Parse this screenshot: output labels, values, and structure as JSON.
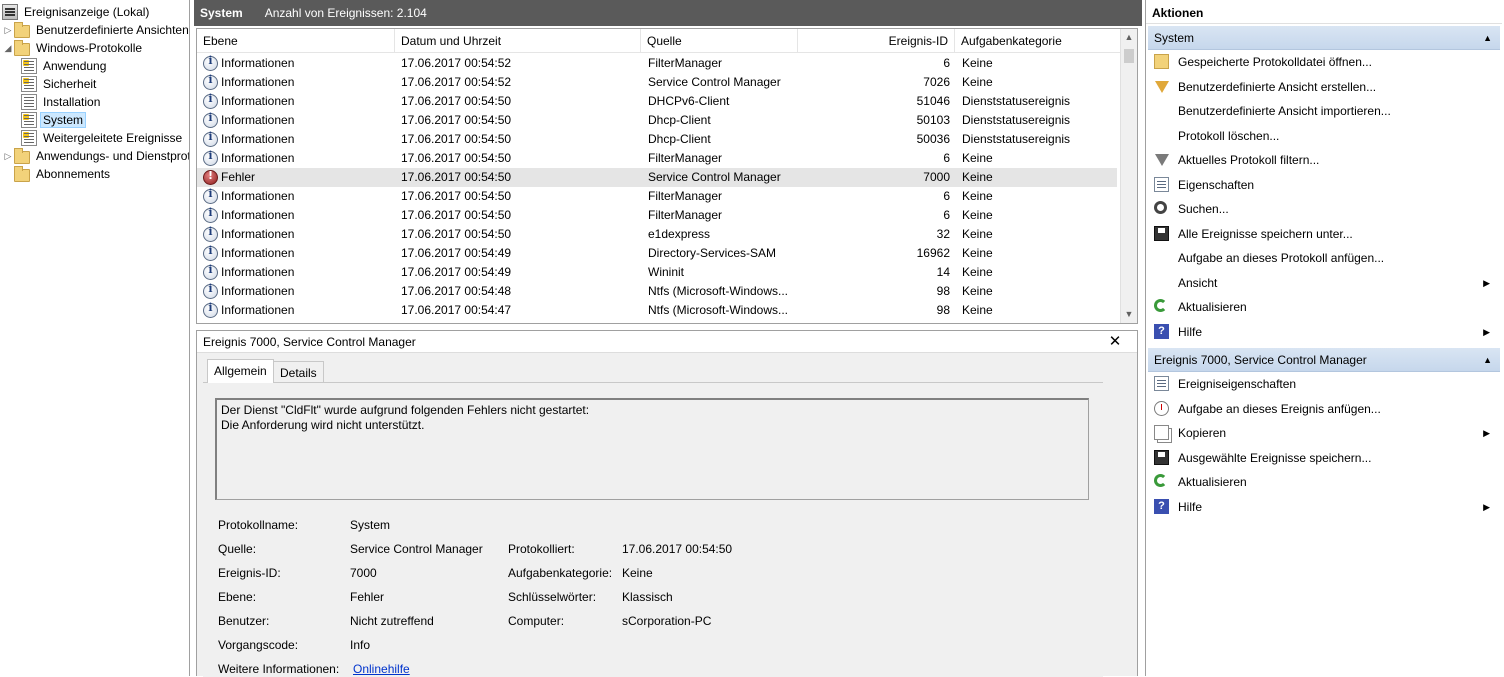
{
  "tree": {
    "root": "Ereignisanzeige (Lokal)",
    "items": [
      {
        "label": "Benutzerdefinierte Ansichten",
        "level": 1,
        "expander": "▷"
      },
      {
        "label": "Windows-Protokolle",
        "level": 1,
        "expander": "◢"
      },
      {
        "label": "Anwendung",
        "level": 2
      },
      {
        "label": "Sicherheit",
        "level": 2
      },
      {
        "label": "Installation",
        "level": 2
      },
      {
        "label": "System",
        "level": 2,
        "selected": true
      },
      {
        "label": "Weitergeleitete Ereignisse",
        "level": 2
      },
      {
        "label": "Anwendungs- und Dienstprotokolle",
        "level": 1,
        "expander": "▷"
      },
      {
        "label": "Abonnements",
        "level": 1
      }
    ]
  },
  "topbar": {
    "title": "System",
    "count": "Anzahl von Ereignissen: 2.104"
  },
  "list": {
    "columns": [
      "Ebene",
      "Datum und Uhrzeit",
      "Quelle",
      "Ereignis-ID",
      "Aufgabenkategorie"
    ],
    "rows": [
      {
        "level": "Informationen",
        "icon": "info",
        "date": "17.06.2017 00:54:52",
        "source": "FilterManager",
        "id": "6",
        "category": "Keine"
      },
      {
        "level": "Informationen",
        "icon": "info",
        "date": "17.06.2017 00:54:52",
        "source": "Service Control Manager",
        "id": "7026",
        "category": "Keine"
      },
      {
        "level": "Informationen",
        "icon": "info",
        "date": "17.06.2017 00:54:50",
        "source": "DHCPv6-Client",
        "id": "51046",
        "category": "Dienststatusereignis"
      },
      {
        "level": "Informationen",
        "icon": "info",
        "date": "17.06.2017 00:54:50",
        "source": "Dhcp-Client",
        "id": "50103",
        "category": "Dienststatusereignis"
      },
      {
        "level": "Informationen",
        "icon": "info",
        "date": "17.06.2017 00:54:50",
        "source": "Dhcp-Client",
        "id": "50036",
        "category": "Dienststatusereignis"
      },
      {
        "level": "Informationen",
        "icon": "info",
        "date": "17.06.2017 00:54:50",
        "source": "FilterManager",
        "id": "6",
        "category": "Keine"
      },
      {
        "level": "Fehler",
        "icon": "error",
        "date": "17.06.2017 00:54:50",
        "source": "Service Control Manager",
        "id": "7000",
        "category": "Keine",
        "selected": true
      },
      {
        "level": "Informationen",
        "icon": "info",
        "date": "17.06.2017 00:54:50",
        "source": "FilterManager",
        "id": "6",
        "category": "Keine"
      },
      {
        "level": "Informationen",
        "icon": "info",
        "date": "17.06.2017 00:54:50",
        "source": "FilterManager",
        "id": "6",
        "category": "Keine"
      },
      {
        "level": "Informationen",
        "icon": "info",
        "date": "17.06.2017 00:54:50",
        "source": "e1dexpress",
        "id": "32",
        "category": "Keine"
      },
      {
        "level": "Informationen",
        "icon": "info",
        "date": "17.06.2017 00:54:49",
        "source": "Directory-Services-SAM",
        "id": "16962",
        "category": "Keine"
      },
      {
        "level": "Informationen",
        "icon": "info",
        "date": "17.06.2017 00:54:49",
        "source": "Wininit",
        "id": "14",
        "category": "Keine"
      },
      {
        "level": "Informationen",
        "icon": "info",
        "date": "17.06.2017 00:54:48",
        "source": "Ntfs (Microsoft-Windows...",
        "id": "98",
        "category": "Keine"
      },
      {
        "level": "Informationen",
        "icon": "info",
        "date": "17.06.2017 00:54:47",
        "source": "Ntfs (Microsoft-Windows...",
        "id": "98",
        "category": "Keine"
      }
    ]
  },
  "detail": {
    "title": "Ereignis 7000, Service Control Manager",
    "close": "✕",
    "tabs": [
      "Allgemein",
      "Details"
    ],
    "message_line1": "Der Dienst \"CldFlt\" wurde aufgrund folgenden Fehlers nicht gestartet:",
    "message_line2": "Die Anforderung wird nicht unterstützt.",
    "labels": {
      "log_name": "Protokollname:",
      "source": "Quelle:",
      "event_id": "Ereignis-ID:",
      "level": "Ebene:",
      "user": "Benutzer:",
      "opcode": "Vorgangscode:",
      "more_info": "Weitere Informationen:",
      "logged": "Protokolliert:",
      "task_category": "Aufgabenkategorie:",
      "keywords": "Schlüsselwörter:",
      "computer": "Computer:"
    },
    "values": {
      "log_name": "System",
      "source": "Service Control Manager",
      "event_id": "7000",
      "level": "Fehler",
      "user": "Nicht zutreffend",
      "opcode": "Info",
      "more_info": "Onlinehilfe",
      "logged": "17.06.2017 00:54:50",
      "task_category": "Keine",
      "keywords": "Klassisch",
      "computer": "sCorporation-PC"
    }
  },
  "actions": {
    "title": "Aktionen",
    "section1": "System",
    "section1_items": [
      {
        "label": "Gespeicherte Protokolldatei öffnen...",
        "icon": "open"
      },
      {
        "label": "Benutzerdefinierte Ansicht erstellen...",
        "icon": "filter-color"
      },
      {
        "label": "Benutzerdefinierte Ansicht importieren...",
        "icon": "none"
      },
      {
        "label": "Protokoll löschen...",
        "icon": "none"
      },
      {
        "label": "Aktuelles Protokoll filtern...",
        "icon": "filter"
      },
      {
        "label": "Eigenschaften",
        "icon": "props"
      },
      {
        "label": "Suchen...",
        "icon": "find"
      },
      {
        "label": "Alle Ereignisse speichern unter...",
        "icon": "save"
      },
      {
        "label": "Aufgabe an dieses Protokoll anfügen...",
        "icon": "none"
      },
      {
        "label": "Ansicht",
        "icon": "none",
        "submenu": true
      },
      {
        "label": "Aktualisieren",
        "icon": "refresh"
      },
      {
        "label": "Hilfe",
        "icon": "help",
        "submenu": true
      }
    ],
    "section2": "Ereignis 7000, Service Control Manager",
    "section2_items": [
      {
        "label": "Ereigniseigenschaften",
        "icon": "props"
      },
      {
        "label": "Aufgabe an dieses Ereignis anfügen...",
        "icon": "clock"
      },
      {
        "label": "Kopieren",
        "icon": "copy",
        "submenu": true
      },
      {
        "label": "Ausgewählte Ereignisse speichern...",
        "icon": "save"
      },
      {
        "label": "Aktualisieren",
        "icon": "refresh"
      },
      {
        "label": "Hilfe",
        "icon": "help",
        "submenu": true
      }
    ],
    "colors": {
      "section_bg": "#c6d7ec",
      "selection": "#cce8ff"
    }
  },
  "glyphs": {
    "submenu": "▶",
    "collapse": "▲",
    "scroll_up": "▲",
    "scroll_down": "▼",
    "help": "?"
  }
}
